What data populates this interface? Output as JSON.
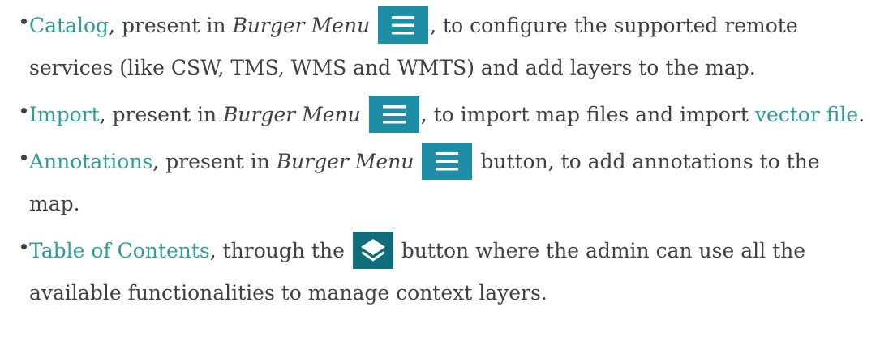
{
  "items": [
    {
      "link": "Catalog",
      "text_a": ", present in ",
      "em": "Burger Menu",
      "text_b": ", to configure the supported remote services (like CSW, TMS, WMS and WMTS) and add layers to the map."
    },
    {
      "link": "Import",
      "text_a": ", present in ",
      "em": "Burger Menu",
      "text_b": ", to import map files and import ",
      "link2": "vector file",
      "text_c": "."
    },
    {
      "link": "Annotations",
      "text_a": ", present in ",
      "em": "Burger Menu",
      "text_b": " button, to add annotations to the map."
    },
    {
      "link": "Table of Contents",
      "text_a": ", through the ",
      "text_b": " button where the admin can use all the available functionalities to manage context layers."
    }
  ],
  "icons": {
    "burger": "burger-menu-icon",
    "layers": "layers-icon"
  },
  "colors": {
    "link": "#2d9c9c",
    "burger_button": "#1e8da6",
    "layers_button": "#0f6d7b",
    "text": "#404040"
  }
}
